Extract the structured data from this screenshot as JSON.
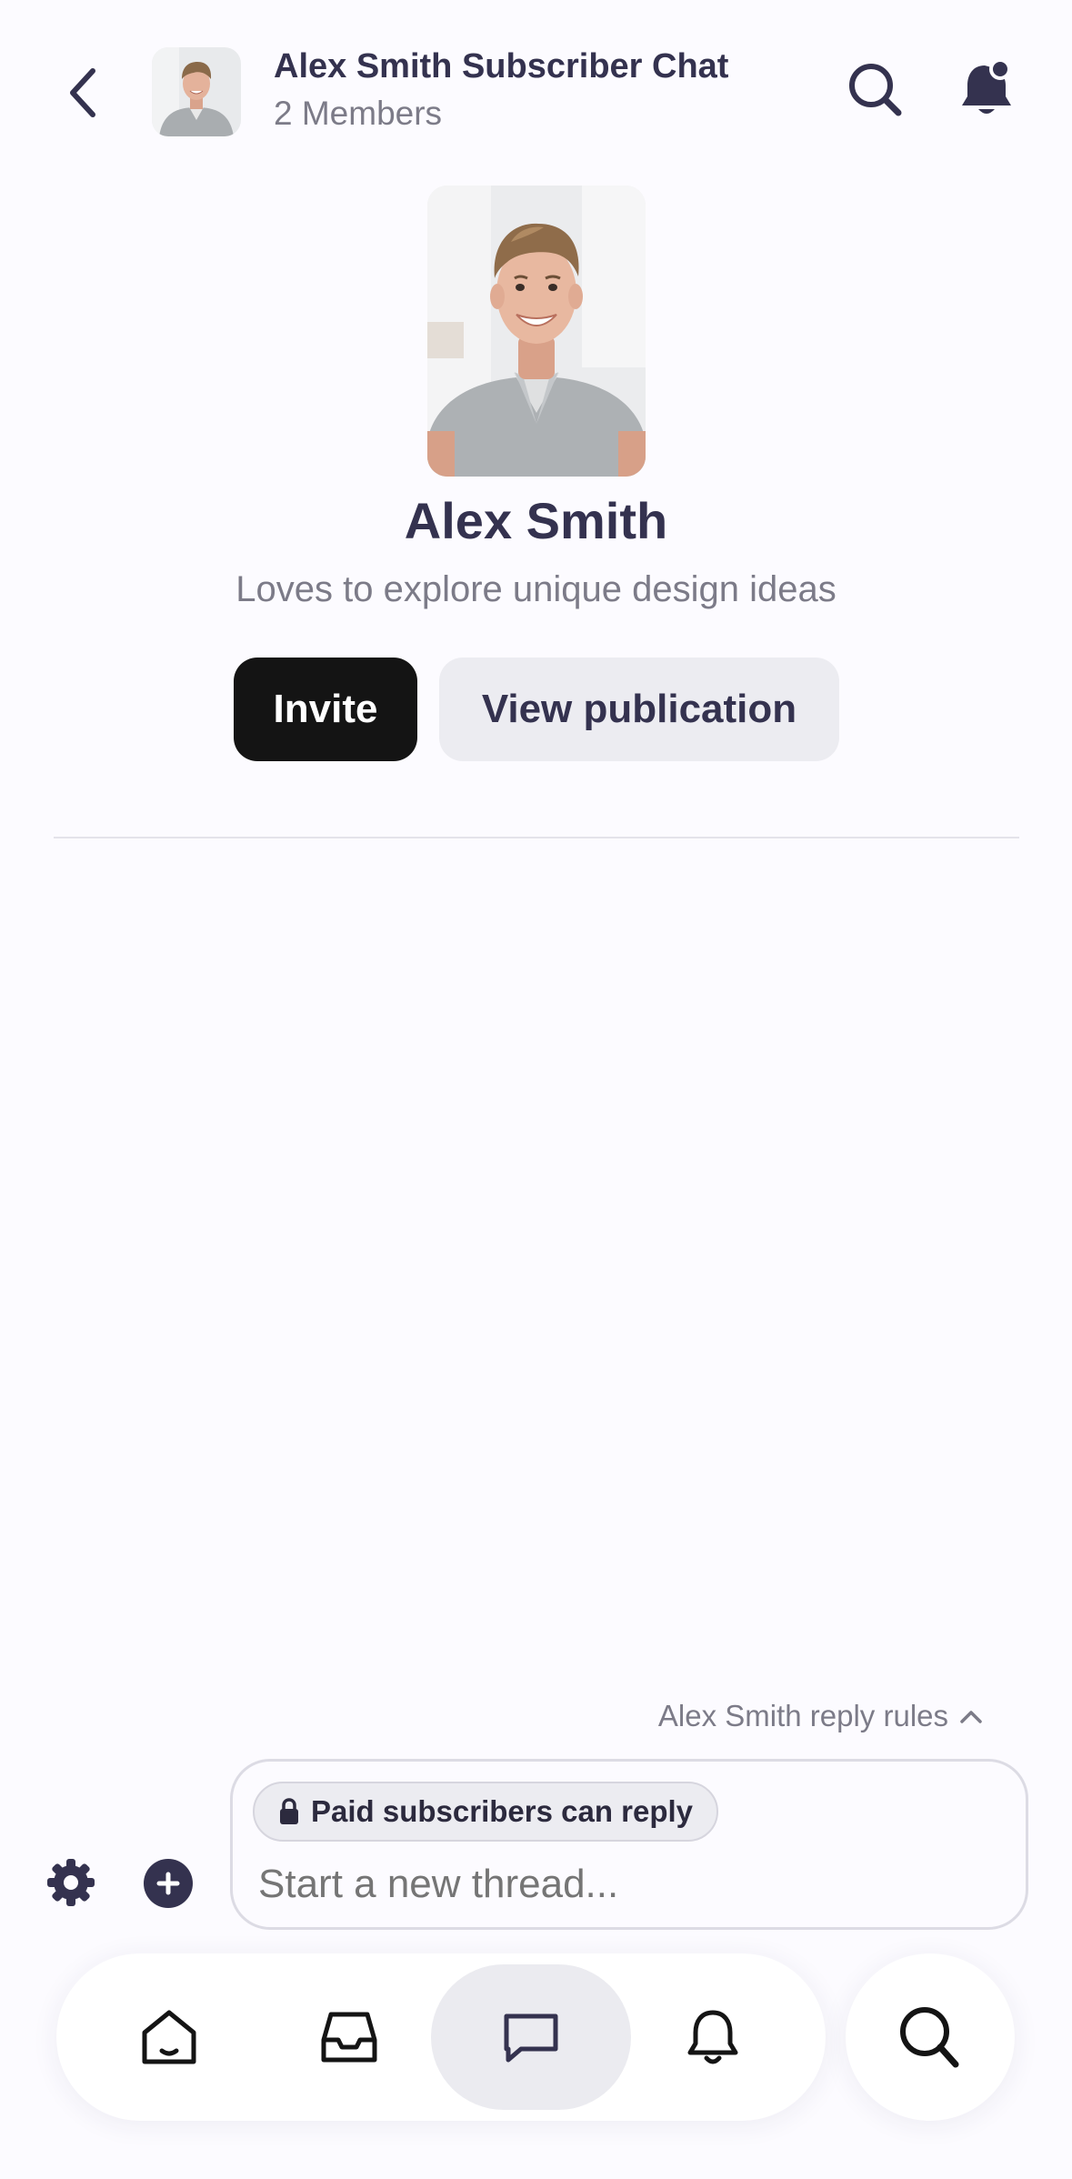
{
  "header": {
    "title": "Alex Smith Subscriber Chat",
    "subtitle": "2 Members"
  },
  "profile": {
    "name": "Alex Smith",
    "bio": "Loves to explore unique design ideas",
    "invite_label": "Invite",
    "view_publication_label": "View publication"
  },
  "composer": {
    "reply_rules_label": "Alex Smith reply rules",
    "paid_pill_label": "Paid subscribers can reply",
    "placeholder": "Start a new thread..."
  },
  "icons": {
    "back": "chevron-left-icon",
    "search": "search-icon",
    "bell": "bell-icon",
    "gear": "gear-icon",
    "plus": "plus-circle-icon",
    "lock": "lock-icon",
    "home": "home-icon",
    "inbox": "inbox-icon",
    "chat": "chat-bubble-icon",
    "notifications": "bell-outline-icon"
  },
  "nav": {
    "active_item": "chat"
  },
  "colors": {
    "primary_text": "#34324f",
    "secondary_text": "#7c7b88",
    "invite_bg": "#141414",
    "secondary_button_bg": "#ececf1",
    "background": "#fcfbff"
  }
}
